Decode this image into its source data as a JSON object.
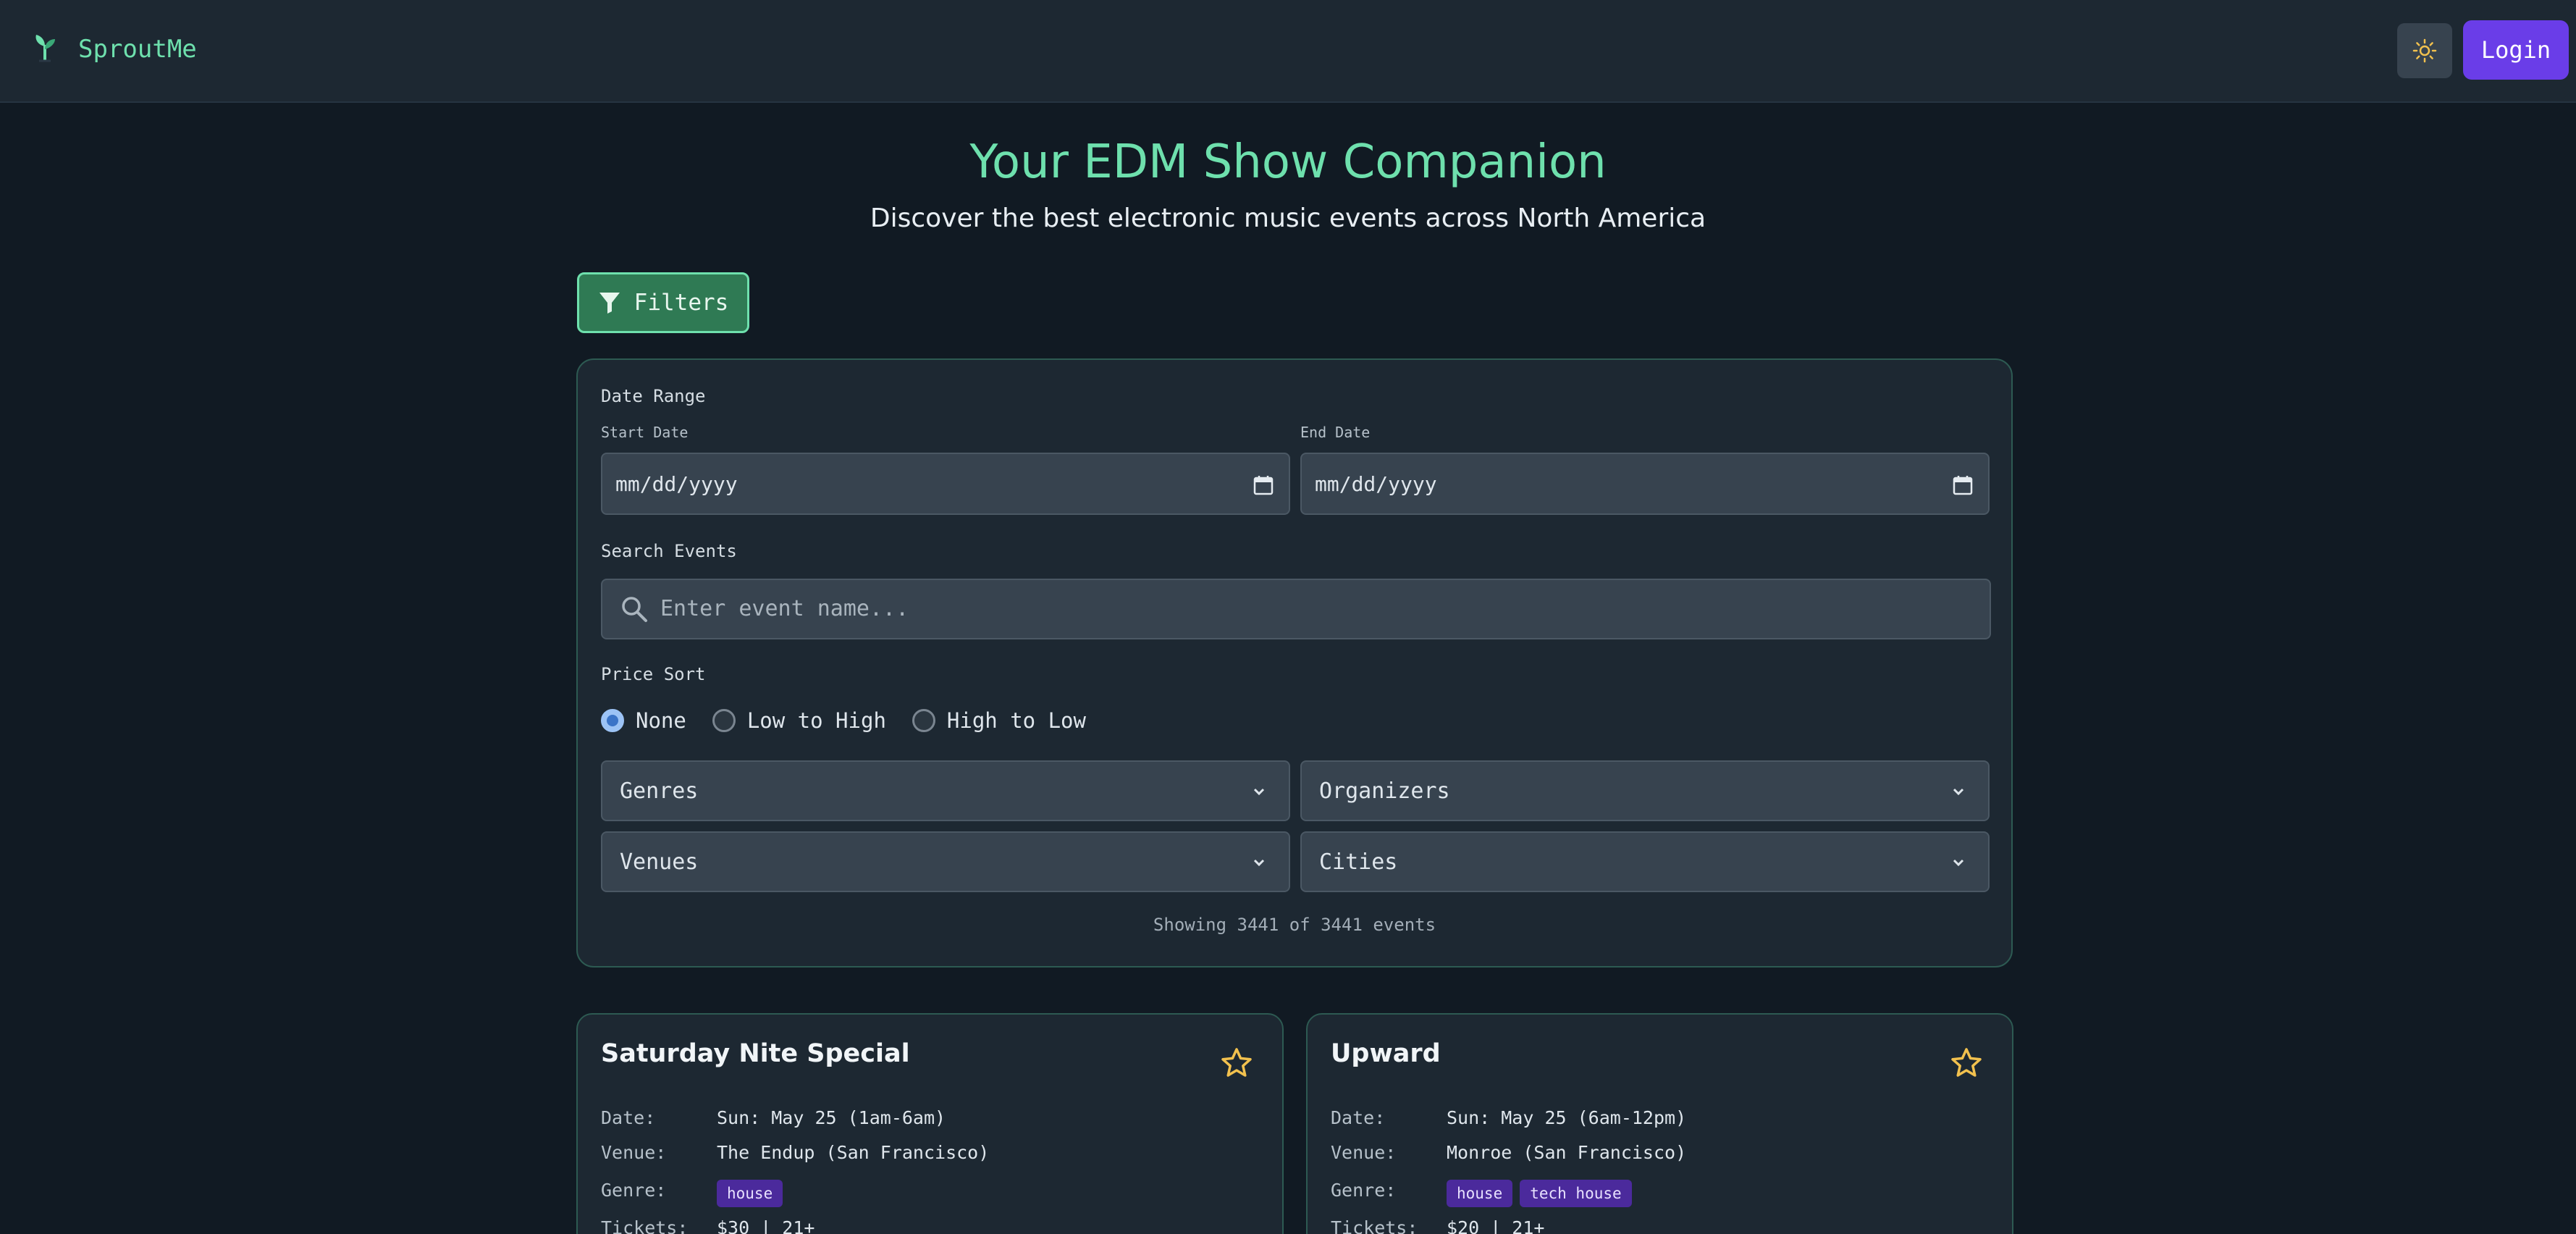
{
  "header": {
    "brand": "SproutMe",
    "login_label": "Login",
    "theme_icon": "sun-icon"
  },
  "hero": {
    "title": "Your EDM Show Companion",
    "subtitle": "Discover the best electronic music events across North America"
  },
  "filters_button": {
    "label": "Filters",
    "icon": "filter-icon"
  },
  "filters": {
    "date_range_label": "Date Range",
    "start_date_label": "Start Date",
    "start_date_value": "mm/dd/yyyy",
    "end_date_label": "End Date",
    "end_date_value": "mm/dd/yyyy",
    "search_label": "Search Events",
    "search_placeholder": "Enter event name...",
    "price_sort_label": "Price Sort",
    "price_sort_options": [
      {
        "label": "None",
        "selected": true
      },
      {
        "label": "Low to High",
        "selected": false
      },
      {
        "label": "High to Low",
        "selected": false
      }
    ],
    "selects": [
      "Genres",
      "Organizers",
      "Venues",
      "Cities"
    ],
    "showing_text": "Showing 3441 of 3441 events"
  },
  "events": [
    {
      "title": "Saturday Nite Special",
      "date_label": "Date:",
      "date": "Sun: May 25 (1am-6am)",
      "venue_label": "Venue:",
      "venue": "The Endup (San Francisco)",
      "genre_label": "Genre:",
      "genres": [
        "house"
      ],
      "tickets_label": "Tickets:",
      "tickets": "$30 | 21+"
    },
    {
      "title": "Upward",
      "date_label": "Date:",
      "date": "Sun: May 25 (6am-12pm)",
      "venue_label": "Venue:",
      "venue": "Monroe (San Francisco)",
      "genre_label": "Genre:",
      "genres": [
        "house",
        "tech house"
      ],
      "tickets_label": "Tickets:",
      "tickets": "$20 | 21+"
    }
  ],
  "colors": {
    "accent": "#6ee0ad",
    "primary_button": "#6a3de8",
    "background": "#111a23",
    "surface": "#1d2832",
    "tag": "#4b2a9c",
    "star": "#f2c14e"
  }
}
